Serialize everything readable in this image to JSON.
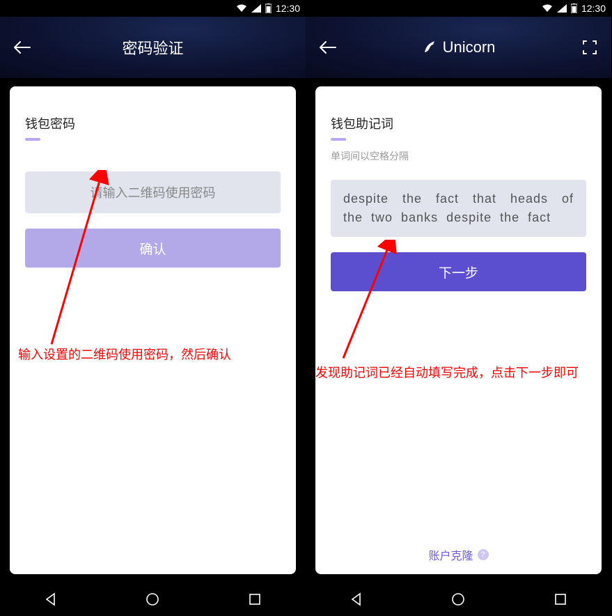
{
  "statusbar": {
    "time": "12:30"
  },
  "left": {
    "header": {
      "title": "密码验证"
    },
    "section_title": "钱包密码",
    "input_placeholder": "请输入二维码使用密码",
    "confirm_label": "确认",
    "annotation": "输入设置的二维码使用密码，然后确认"
  },
  "right": {
    "header": {
      "title": "Unicorn"
    },
    "section_title": "钱包助记词",
    "subtitle": "单词间以空格分隔",
    "mnemonic_value": "despite the fact that heads of the two banks despite the fact",
    "next_label": "下一步",
    "footer_link": "账户克隆",
    "annotation": "发现助记词已经自动填写完成，点击下一步即可"
  },
  "colors": {
    "accent": "#5b4ecf",
    "accent_light": "#b3a9e8",
    "annotation": "#ff0000"
  }
}
